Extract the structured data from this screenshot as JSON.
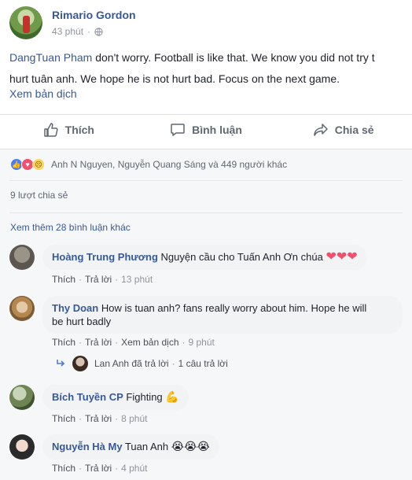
{
  "post": {
    "author": "Rimario Gordon",
    "time": "43 phút",
    "privacy_icon": "globe-icon",
    "mention": "DangTuan Pham",
    "text_line1": " don't worry. Football is like that. We know you did not try t",
    "text_line2": "hurt tuân anh. We hope he is not hurt bad. Focus on the next game.",
    "translate_label": "Xem bản dịch"
  },
  "actions": {
    "like": "Thích",
    "comment": "Bình luận",
    "share": "Chia sẻ"
  },
  "reactions": {
    "icons": [
      "like-reaction-icon",
      "love-reaction-icon",
      "sad-reaction-icon"
    ],
    "summary": "Anh N Nguyen, Nguyễn Quang Sáng và 449 người khác"
  },
  "shares": "9 lượt chia sẻ",
  "more_comments": "Xem thêm 28 bình luận khác",
  "comments": [
    {
      "name": "Hoàng Trung Phương",
      "text": "Nguyện cầu cho Tuấn Anh Ơn chúa",
      "hearts": "❤❤❤",
      "like": "Thích",
      "reply": "Trả lời",
      "time": "13 phút"
    },
    {
      "name": "Thy Doan",
      "text_line1": "How is tuan anh? fans really worry about him. Hope he will",
      "text_line2": "be hurt badly",
      "like": "Thích",
      "reply": "Trả lời",
      "translate": "Xem bản dịch",
      "time": "9 phút",
      "reply_summary": "Lan Anh đã trả lời",
      "reply_count": "1 câu trả lời"
    },
    {
      "name": "Bích Tuyền CP",
      "text": "Fighting",
      "emoji": "💪",
      "like": "Thích",
      "reply": "Trả lời",
      "time": "8 phút"
    },
    {
      "name": "Nguyễn Hà My",
      "text": "Tuan Anh",
      "emoji": "😭😭😭",
      "like": "Thích",
      "reply": "Trả lời",
      "time": "4 phút"
    }
  ],
  "colors": {
    "link": "#365899",
    "name": "#385898",
    "muted": "#90949c",
    "bubble": "#f2f3f5"
  }
}
